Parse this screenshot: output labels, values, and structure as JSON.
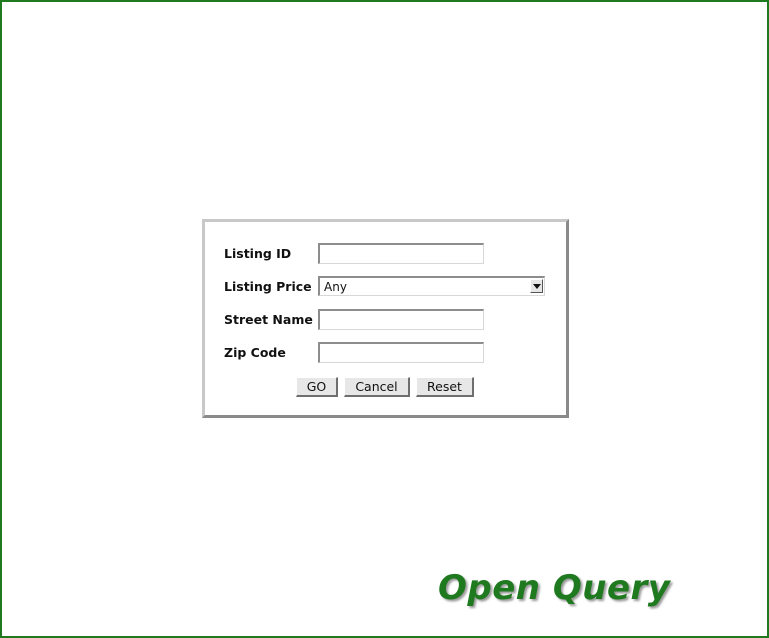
{
  "form": {
    "fields": [
      {
        "label": "Listing ID",
        "value": ""
      },
      {
        "label": "Listing Price",
        "value": "Any"
      },
      {
        "label": "Street Name",
        "value": ""
      },
      {
        "label": "Zip Code",
        "value": ""
      }
    ],
    "buttons": {
      "go": "GO",
      "cancel": "Cancel",
      "reset": "Reset"
    }
  },
  "brand": {
    "title": "Open Query",
    "color": "#1f7a1f"
  },
  "colors": {
    "frame_border": "#1f7a1f",
    "dialog_background": "#ffffff"
  },
  "icons": {
    "dropdown": "chevron-down-icon"
  }
}
